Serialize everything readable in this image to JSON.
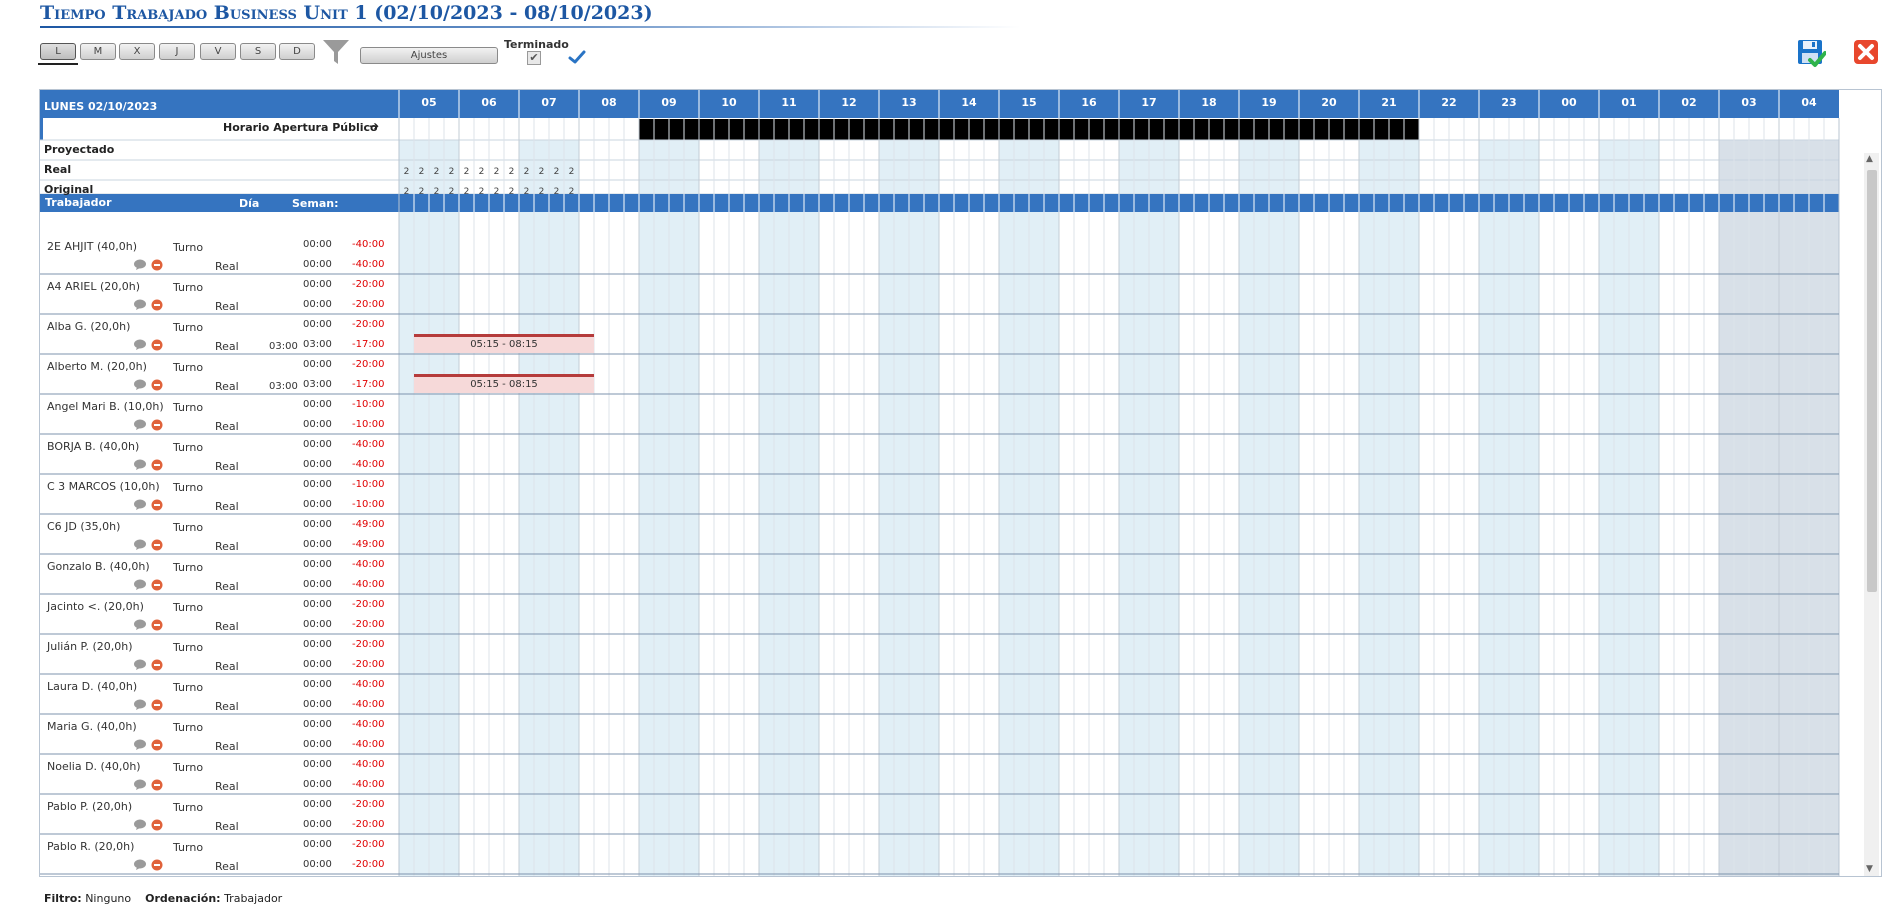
{
  "header": {
    "title": "Tiempo Trabajado Business Unit 1 (02/10/2023 - 08/10/2023)",
    "day_buttons": [
      "L",
      "M",
      "X",
      "J",
      "V",
      "S",
      "D"
    ],
    "active_day": "L",
    "settings_label": "Ajustes",
    "finished_label": "Terminado",
    "finished_checked": true,
    "icons": [
      "filter-icon",
      "check-icon",
      "save-icon",
      "close-icon"
    ]
  },
  "grid": {
    "date_label": "LUNES 02/10/2023",
    "hours": [
      "05",
      "06",
      "07",
      "08",
      "09",
      "10",
      "11",
      "12",
      "13",
      "14",
      "15",
      "16",
      "17",
      "18",
      "19",
      "20",
      "21",
      "22",
      "23",
      "00",
      "01",
      "02",
      "03",
      "04"
    ],
    "opening_hours_label": "Horario Apertura Público",
    "opening_hours_color": "#7ac75f",
    "summary_rows": [
      {
        "label": "Proyectado",
        "values": []
      },
      {
        "label": "Real",
        "values": [
          "2",
          "2",
          "2",
          "2",
          "2",
          "2",
          "2",
          "2",
          "2",
          "2",
          "2",
          "2"
        ]
      },
      {
        "label": "Original",
        "values": [
          "2",
          "2",
          "2",
          "2",
          "2",
          "2",
          "2",
          "2",
          "2",
          "2",
          "2",
          "2"
        ]
      }
    ],
    "columns": {
      "worker": "Trabajador",
      "day": "Día",
      "week": "Seman:"
    },
    "row_labels": {
      "shift": "Turno",
      "real": "Real"
    },
    "workers": [
      {
        "name": "2E AHJIT (40,0h)",
        "turno_week": "00:00",
        "turno_diff": "-40:00",
        "real_day": "",
        "real_week": "00:00",
        "real_diff": "-40:00",
        "shift": ""
      },
      {
        "name": "A4 ARIEL (20,0h)",
        "turno_week": "00:00",
        "turno_diff": "-20:00",
        "real_day": "",
        "real_week": "00:00",
        "real_diff": "-20:00",
        "shift": ""
      },
      {
        "name": "Alba G. (20,0h)",
        "turno_week": "00:00",
        "turno_diff": "-20:00",
        "real_day": "03:00",
        "real_week": "03:00",
        "real_diff": "-17:00",
        "shift": "05:15 - 08:15"
      },
      {
        "name": "Alberto M. (20,0h)",
        "turno_week": "00:00",
        "turno_diff": "-20:00",
        "real_day": "03:00",
        "real_week": "03:00",
        "real_diff": "-17:00",
        "shift": "05:15 - 08:15"
      },
      {
        "name": "Angel Mari B. (10,0h)",
        "turno_week": "00:00",
        "turno_diff": "-10:00",
        "real_day": "",
        "real_week": "00:00",
        "real_diff": "-10:00",
        "shift": ""
      },
      {
        "name": "BORJA B. (40,0h)",
        "turno_week": "00:00",
        "turno_diff": "-40:00",
        "real_day": "",
        "real_week": "00:00",
        "real_diff": "-40:00",
        "shift": ""
      },
      {
        "name": "C 3 MARCOS (10,0h)",
        "turno_week": "00:00",
        "turno_diff": "-10:00",
        "real_day": "",
        "real_week": "00:00",
        "real_diff": "-10:00",
        "shift": ""
      },
      {
        "name": "C6 JD (35,0h)",
        "turno_week": "00:00",
        "turno_diff": "-49:00",
        "real_day": "",
        "real_week": "00:00",
        "real_diff": "-49:00",
        "shift": ""
      },
      {
        "name": "Gonzalo B. (40,0h)",
        "turno_week": "00:00",
        "turno_diff": "-40:00",
        "real_day": "",
        "real_week": "00:00",
        "real_diff": "-40:00",
        "shift": ""
      },
      {
        "name": "Jacinto <. (20,0h)",
        "turno_week": "00:00",
        "turno_diff": "-20:00",
        "real_day": "",
        "real_week": "00:00",
        "real_diff": "-20:00",
        "shift": ""
      },
      {
        "name": "Julián P. (20,0h)",
        "turno_week": "00:00",
        "turno_diff": "-20:00",
        "real_day": "",
        "real_week": "00:00",
        "real_diff": "-20:00",
        "shift": ""
      },
      {
        "name": "Laura D. (40,0h)",
        "turno_week": "00:00",
        "turno_diff": "-40:00",
        "real_day": "",
        "real_week": "00:00",
        "real_diff": "-40:00",
        "shift": ""
      },
      {
        "name": "Maria G. (40,0h)",
        "turno_week": "00:00",
        "turno_diff": "-40:00",
        "real_day": "",
        "real_week": "00:00",
        "real_diff": "-40:00",
        "shift": ""
      },
      {
        "name": "Noelia D. (40,0h)",
        "turno_week": "00:00",
        "turno_diff": "-40:00",
        "real_day": "",
        "real_week": "00:00",
        "real_diff": "-40:00",
        "shift": ""
      },
      {
        "name": "Pablo P. (20,0h)",
        "turno_week": "00:00",
        "turno_diff": "-20:00",
        "real_day": "",
        "real_week": "00:00",
        "real_diff": "-20:00",
        "shift": ""
      },
      {
        "name": "Pablo R. (20,0h)",
        "turno_week": "00:00",
        "turno_diff": "-20:00",
        "real_day": "",
        "real_week": "00:00",
        "real_diff": "-20:00",
        "shift": ""
      }
    ]
  },
  "footer": {
    "filter_label": "Filtro:",
    "filter_value": "Ninguno",
    "order_label": "Ordenación:",
    "order_value": "Trabajador"
  },
  "colors": {
    "brand_blue": "#3574c0",
    "title_blue": "#1d57a3",
    "negative_red": "#e00000",
    "shift_fill": "#f6d9d9",
    "shift_border": "#b53b3b",
    "alt_hour_fill": "#e1eff6",
    "night_fill": "#d8e0e8",
    "save_icon": "#1a73c9",
    "close_icon": "#e8472d"
  }
}
